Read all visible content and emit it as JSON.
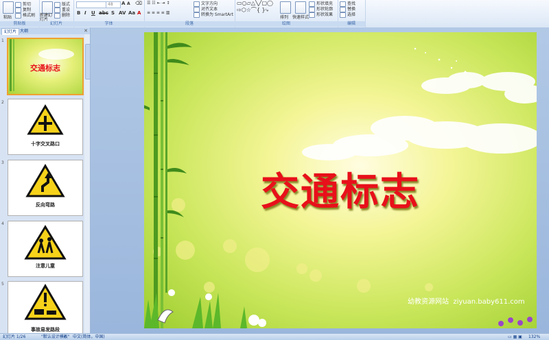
{
  "ribbon": {
    "groups": [
      {
        "name": "剪贴板",
        "buttons": [
          "粘贴",
          "剪切",
          "复制",
          "格式刷"
        ]
      },
      {
        "name": "幻灯片",
        "buttons": [
          "新建幻灯片",
          "版式",
          "重设",
          "删除"
        ]
      },
      {
        "name": "字体",
        "font_size": "48"
      },
      {
        "name": "段落",
        "buttons": [
          "文字方向",
          "对齐文本",
          "转换为 SmartArt"
        ]
      },
      {
        "name": "绘图",
        "buttons": [
          "排列",
          "快速样式",
          "形状填充",
          "形状轮廓",
          "形状效果"
        ]
      },
      {
        "name": "编辑",
        "buttons": [
          "查找",
          "替换",
          "选择"
        ]
      }
    ]
  },
  "panel": {
    "tabs": [
      "幻灯片",
      "大纲"
    ],
    "close_icon": "close-icon"
  },
  "slides": [
    {
      "number": "1",
      "title": "交通标志"
    },
    {
      "number": "2",
      "caption": "十字交叉路口"
    },
    {
      "number": "3",
      "caption": "反向弯路"
    },
    {
      "number": "4",
      "caption": "注意儿童"
    },
    {
      "number": "5",
      "caption": "事故易发路段"
    }
  ],
  "main_slide": {
    "title": "交通标志",
    "watermark": "幼教资源网站  ziyuan.baby611.com"
  },
  "status": {
    "slide": "幻灯片 1/26",
    "theme": "\"默认设计模板\"",
    "lang": "中文(简体，中国)",
    "zoom": "132%"
  },
  "colors": {
    "title": "#e8101a",
    "sign_yellow": "#f6d21a"
  }
}
